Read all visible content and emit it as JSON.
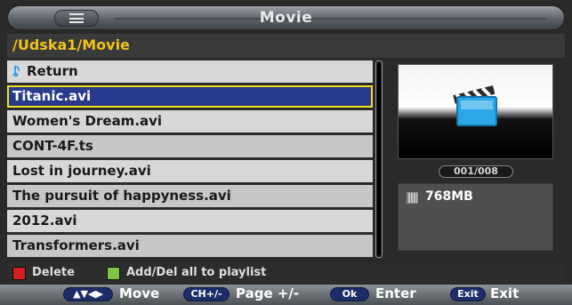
{
  "header": {
    "title": "Movie"
  },
  "path": "/Udska1/Movie",
  "files": [
    "Return",
    "Titanic.avi",
    "Women's Dream.avi",
    "CONT-4F.ts",
    "Lost in journey.avi",
    "The pursuit of happyness.avi",
    "2012.avi",
    "Transformers.avi"
  ],
  "selected_index": 1,
  "counter": "001/008",
  "file_info": {
    "size": "768MB"
  },
  "legend": {
    "red_label": "Delete",
    "green_label": "Add/Del all to playlist"
  },
  "help": [
    {
      "key": "▲▼◀▶",
      "label": "Move"
    },
    {
      "key": "CH+/-",
      "label": "Page +/-"
    },
    {
      "key": "Ok",
      "label": "Enter"
    },
    {
      "key": "Exit",
      "label": "Exit"
    }
  ],
  "colors": {
    "selection": "#283a8c",
    "selection_border": "#f0e020",
    "path_text": "#f1c21b",
    "delete_key": "#d21f1f",
    "playlist_key": "#7cc442"
  },
  "icons": {
    "menu": "list-menu-icon",
    "return": "music-note-icon",
    "preview": "clapperboard-icon",
    "file": "file-info-icon"
  }
}
